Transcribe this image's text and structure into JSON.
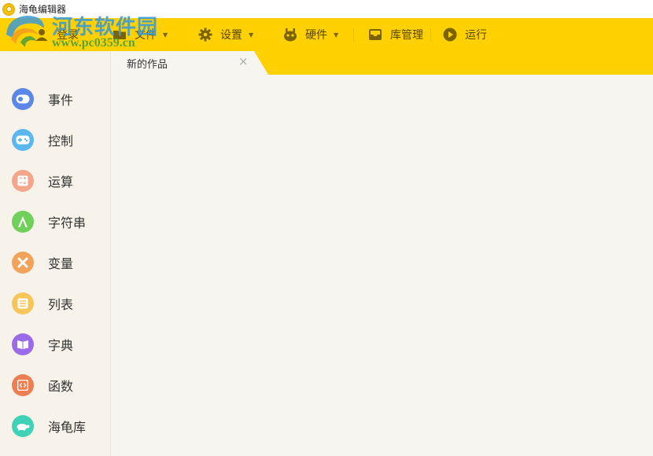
{
  "window": {
    "title": "海龟编辑器"
  },
  "watermark": {
    "site_name": "河东软件园",
    "url": "www.pc0359.cn"
  },
  "toolbar": {
    "login_label": "登录",
    "file_label": "文件",
    "settings_label": "设置",
    "hardware_label": "硬件",
    "library_label": "库管理",
    "run_label": "运行"
  },
  "tabs": [
    {
      "label": "新的作品",
      "close": "×"
    }
  ],
  "sidebar": {
    "items": [
      {
        "label": "事件",
        "icon": "toggle-icon",
        "color": "#5b87e8"
      },
      {
        "label": "控制",
        "icon": "gamepad-icon",
        "color": "#5bb8ef"
      },
      {
        "label": "运算",
        "icon": "calculator-icon",
        "color": "#f3a68c"
      },
      {
        "label": "字符串",
        "icon": "letter-a-icon",
        "color": "#6fd05a"
      },
      {
        "label": "变量",
        "icon": "x-variable-icon",
        "color": "#f2a25a"
      },
      {
        "label": "列表",
        "icon": "list-icon",
        "color": "#f6c65a"
      },
      {
        "label": "字典",
        "icon": "book-icon",
        "color": "#9b6ae8"
      },
      {
        "label": "函数",
        "icon": "code-icon",
        "color": "#ee7f52"
      },
      {
        "label": "海龟库",
        "icon": "turtle-icon",
        "color": "#3fd2b6"
      }
    ]
  },
  "colors": {
    "toolbar_bg": "#ffd100",
    "accent": "#ffd100"
  }
}
